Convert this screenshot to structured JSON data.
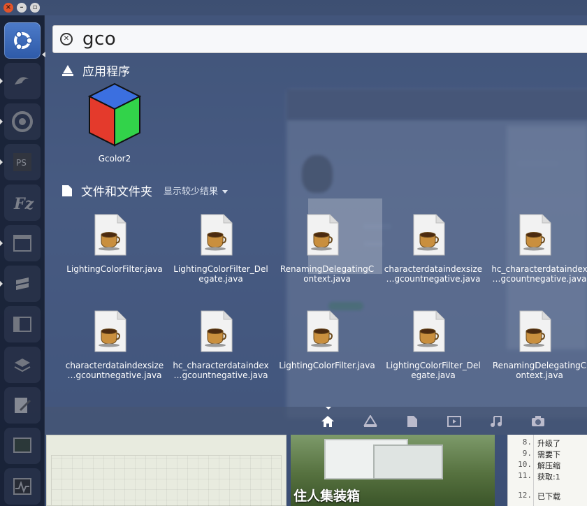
{
  "search": {
    "query": "gco"
  },
  "categories": {
    "applications": {
      "label": "应用程序"
    },
    "files": {
      "label": "文件和文件夹",
      "filter_label": "显示较少结果"
    }
  },
  "apps": [
    {
      "name": "Gcolor2",
      "icon": "color-cube-icon"
    }
  ],
  "files": [
    {
      "name": "LightingColorFilter.java",
      "icon": "java-file-icon"
    },
    {
      "name": "LightingColorFilter_Del\negate.java",
      "icon": "java-file-icon"
    },
    {
      "name": "RenamingDelegatingC\nontext.java",
      "icon": "java-file-icon",
      "selected": true
    },
    {
      "name": "characterdataindexsize\n…gcountnegative.java",
      "icon": "java-file-icon"
    },
    {
      "name": "hc_characterdataindex\n…gcountnegative.java",
      "icon": "java-file-icon"
    },
    {
      "name": "characterdataindexsize\n…gcountnegative.java",
      "icon": "java-file-icon"
    },
    {
      "name": "hc_characterdataindex\n…gcountnegative.java",
      "icon": "java-file-icon"
    },
    {
      "name": "LightingColorFilter.java",
      "icon": "java-file-icon"
    },
    {
      "name": "LightingColorFilter_Del\negate.java",
      "icon": "java-file-icon"
    },
    {
      "name": "RenamingDelegatingC\nontext.java",
      "icon": "java-file-icon"
    }
  ],
  "lenses": [
    "home-lens-icon",
    "apps-lens-icon",
    "files-lens-icon",
    "video-lens-icon",
    "music-lens-icon",
    "photo-lens-icon"
  ],
  "background": {
    "photo_caption": "住人集装箱",
    "code_lines": [
      {
        "num": "8.",
        "text": "升级了"
      },
      {
        "num": "9.",
        "text": "需要下"
      },
      {
        "num": "10.",
        "text": "解压缩"
      },
      {
        "num": "11.",
        "text": "获取:1"
      },
      {
        "num": "12.",
        "text": "已下载"
      }
    ]
  },
  "colors": {
    "accent": "#2e5aa8",
    "close": "#e3542a"
  }
}
